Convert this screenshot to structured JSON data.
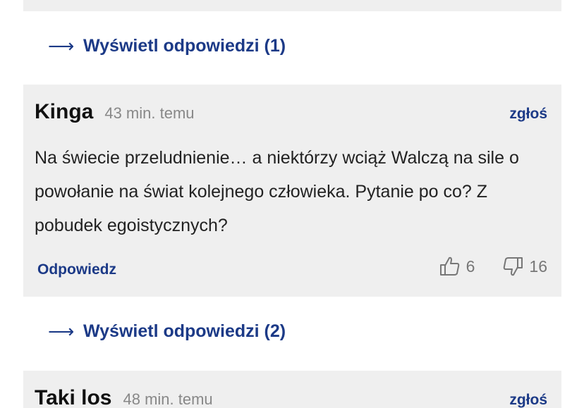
{
  "thread": [
    {
      "replies_label": "Wyświetl odpowiedzi (1)"
    },
    {
      "author": "Kinga",
      "time": "43 min. temu",
      "report_label": "zgłoś",
      "body": "Na świecie przeludnienie… a niektórzy wciąż Walczą na sile o powołanie na świat kolejnego człowieka. Pytanie po co? Z pobudek egoistycznych?",
      "reply_label": "Odpowiedz",
      "likes": "6",
      "dislikes": "16",
      "replies_label": "Wyświetl odpowiedzi (2)"
    },
    {
      "author": "Taki los",
      "time": "48 min. temu",
      "report_label": "zgłoś"
    }
  ],
  "icons": {
    "replies_arrow": "right-arrow-icon",
    "like": "thumbs-up-icon",
    "dislike": "thumbs-down-icon"
  },
  "colors": {
    "link": "#1c3a87",
    "card_background": "#efefef",
    "meta_text": "#888888"
  }
}
